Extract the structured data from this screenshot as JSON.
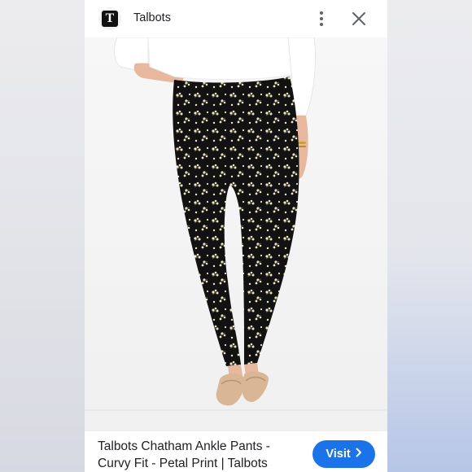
{
  "header": {
    "site_name": "Talbots",
    "logo_letter": "T"
  },
  "image": {
    "subject": "woman wearing black petal print ankle pants with loafers"
  },
  "caption": {
    "title": "Talbots Chatham Ankle Pants - Curvy Fit - Petal Print | Talbots"
  },
  "actions": {
    "visit_label": "Visit"
  },
  "colors": {
    "accent": "#1a73e8",
    "text": "#202124",
    "pants": "#111111",
    "print": "#efe8c8"
  },
  "icons": {
    "more": "more-vert-icon",
    "close": "close-icon",
    "chevron": "chevron-right-icon"
  }
}
